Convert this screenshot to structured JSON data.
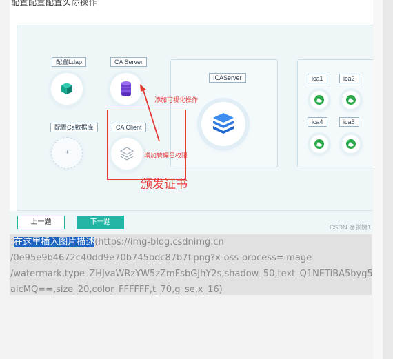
{
  "shot": {
    "top_text": "配置配置配置实际操作",
    "nodes": {
      "ldap_label": "配置Ldap",
      "ca_server_label": "CA Server",
      "ca_db_label": "配置Ca数据库",
      "ca_client_label": "CA Client",
      "ica_server_label": "ICAServer",
      "ica_labels": [
        "ica1",
        "ica2",
        "ica4",
        "ica5"
      ],
      "plus": "+"
    },
    "annotations": {
      "visual_op": "添加可视化操作",
      "admin_perm": "增加管理员权限",
      "issue_cert": "颁发证书"
    },
    "buttons": {
      "prev": "上一题",
      "next": "下一题"
    },
    "watermark": "CSDN @张婕1",
    "colors": {
      "accent": "#23b6a5",
      "annotation": "#e53935",
      "cube": "#2f7de1"
    }
  },
  "caption": {
    "prefix": "!",
    "selected": "在这里插入图片描述",
    "line1_rest": "(https://img-blog.csdnimg.cn",
    "line2": "/0e95e9b4672c40dd9e70b745bdc87b7f.png?x-oss-process=image",
    "line3": "/watermark,type_ZHJvaWRzYW5zZmFsbGJhY2s,shadow_50,text_Q1NETiBA5byg5",
    "line4": "aicMQ==,size_20,color_FFFFFF,t_70,g_se,x_16)"
  }
}
